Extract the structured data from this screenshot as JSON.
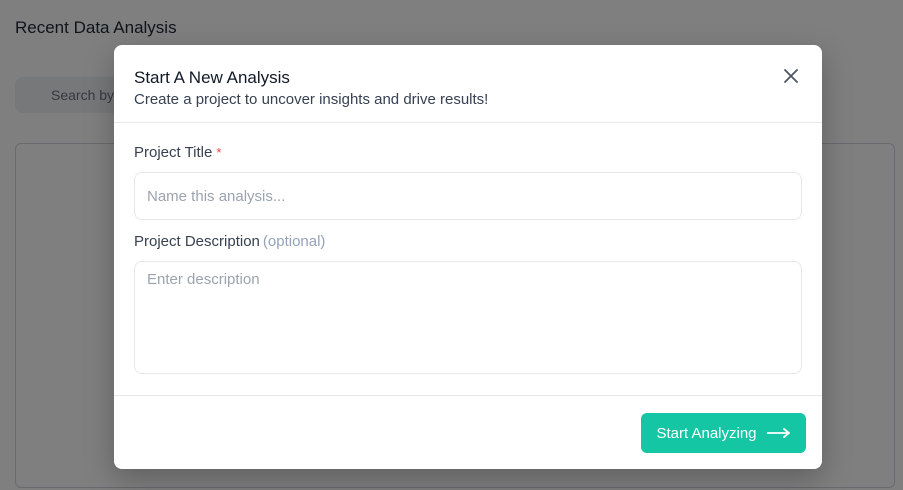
{
  "background": {
    "title": "Recent Data Analysis",
    "search_placeholder": "Search by"
  },
  "modal": {
    "title": "Start A New Analysis",
    "subtitle": "Create a project to uncover insights and drive results!",
    "close_icon": "close-icon",
    "project_title": {
      "label": "Project Title",
      "required_marker": "*",
      "placeholder": "Name this analysis..."
    },
    "project_description": {
      "label": "Project Description",
      "optional_text": "(optional)",
      "placeholder": "Enter description"
    },
    "submit": {
      "label": "Start Analyzing",
      "icon": "arrow-right-icon"
    }
  },
  "colors": {
    "accent": "#14c6a4",
    "required": "#ef4444",
    "optional": "#94a3b8"
  }
}
